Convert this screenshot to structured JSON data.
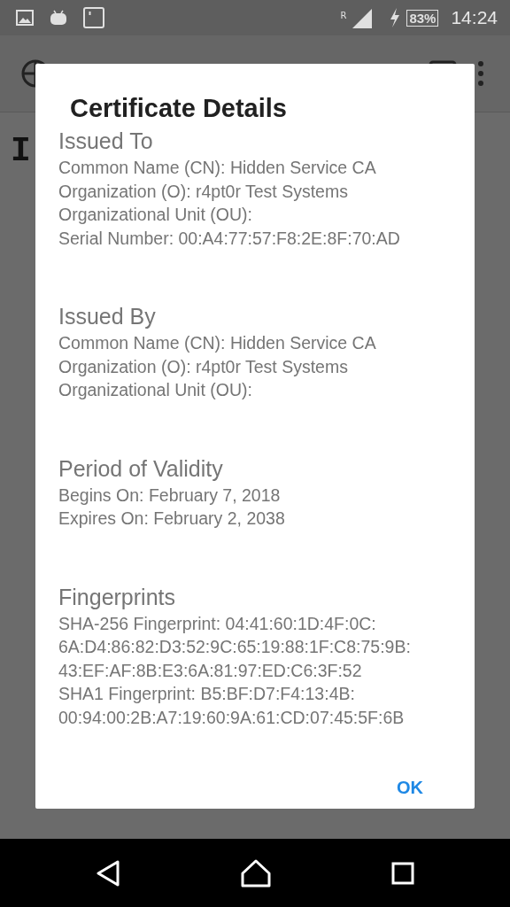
{
  "status_bar": {
    "battery": "83%",
    "time": "14:24",
    "roaming": "R"
  },
  "page_heading": "I",
  "dialog": {
    "title": "Certificate Details",
    "sections": [
      {
        "heading": "Issued To",
        "lines": [
          "Common Name (CN): Hidden Service CA",
          "Organization (O): r4pt0r Test Systems",
          "Organizational Unit (OU):",
          "Serial Number: 00:A4:77:57:F8:2E:8F:70:AD"
        ]
      },
      {
        "heading": "Issued By",
        "lines": [
          "Common Name (CN): Hidden Service CA",
          "Organization (O): r4pt0r Test Systems",
          "Organizational Unit (OU):"
        ]
      },
      {
        "heading": "Period of Validity",
        "lines": [
          "Begins On: February 7, 2018",
          "Expires On: February 2, 2038"
        ]
      },
      {
        "heading": "Fingerprints",
        "lines": [
          "SHA-256 Fingerprint: 04:41:60:1D:4F:0C:",
          "6A:D4:86:82:D3:52:9C:65:19:88:1F:C8:75:9B:",
          "43:EF:AF:8B:E3:6A:81:97:ED:C6:3F:52",
          "SHA1 Fingerprint: B5:BF:D7:F4:13:4B:",
          "00:94:00:2B:A7:19:60:9A:61:CD:07:45:5F:6B"
        ]
      }
    ],
    "buttons": [
      "OK"
    ]
  }
}
